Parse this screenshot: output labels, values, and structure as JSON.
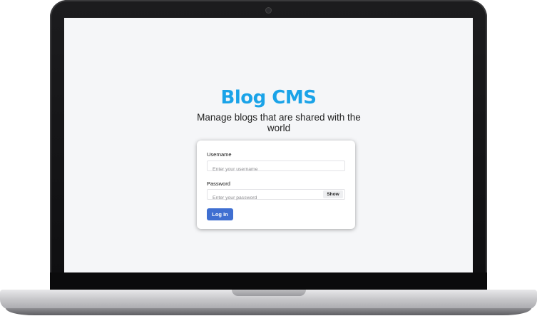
{
  "app": {
    "title": "Blog CMS",
    "tagline": "Manage blogs that are shared with the world"
  },
  "login_form": {
    "username_label": "Username",
    "username_placeholder": "Enter your username",
    "username_value": "",
    "password_label": "Password",
    "password_placeholder": "Enter your password",
    "password_value": "",
    "show_label": "Show",
    "login_label": "Log In"
  },
  "colors": {
    "brand": "#1aa3e8",
    "primary_button": "#3f6fd1",
    "screen_background": "#f5f6f8"
  }
}
